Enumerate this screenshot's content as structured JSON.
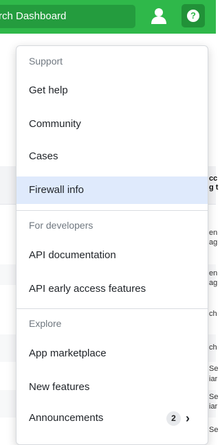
{
  "header": {
    "search_text": "rch Dashboard"
  },
  "icons": {
    "user": "user-icon",
    "help": "question-icon"
  },
  "menu": {
    "sections": [
      {
        "label": "Support",
        "items": [
          "Get help",
          "Community",
          "Cases",
          "Firewall info"
        ]
      },
      {
        "label": "For developers",
        "items": [
          "API documentation",
          "API early access features"
        ]
      },
      {
        "label": "Explore",
        "items": [
          "App marketplace",
          "New features",
          "Announcements"
        ]
      }
    ],
    "announcements_badge": "2",
    "active_item": "Firewall info"
  },
  "background": {
    "header_text_1": "cc",
    "header_text_2": "g t",
    "rows": [
      "en",
      "ag",
      "en",
      "ag",
      "ch",
      "ch",
      "Se",
      "iar",
      "Se",
      "iar",
      "Se"
    ]
  },
  "colors": {
    "topbar": "#2fb84a",
    "active_bg": "#dfeafc"
  }
}
